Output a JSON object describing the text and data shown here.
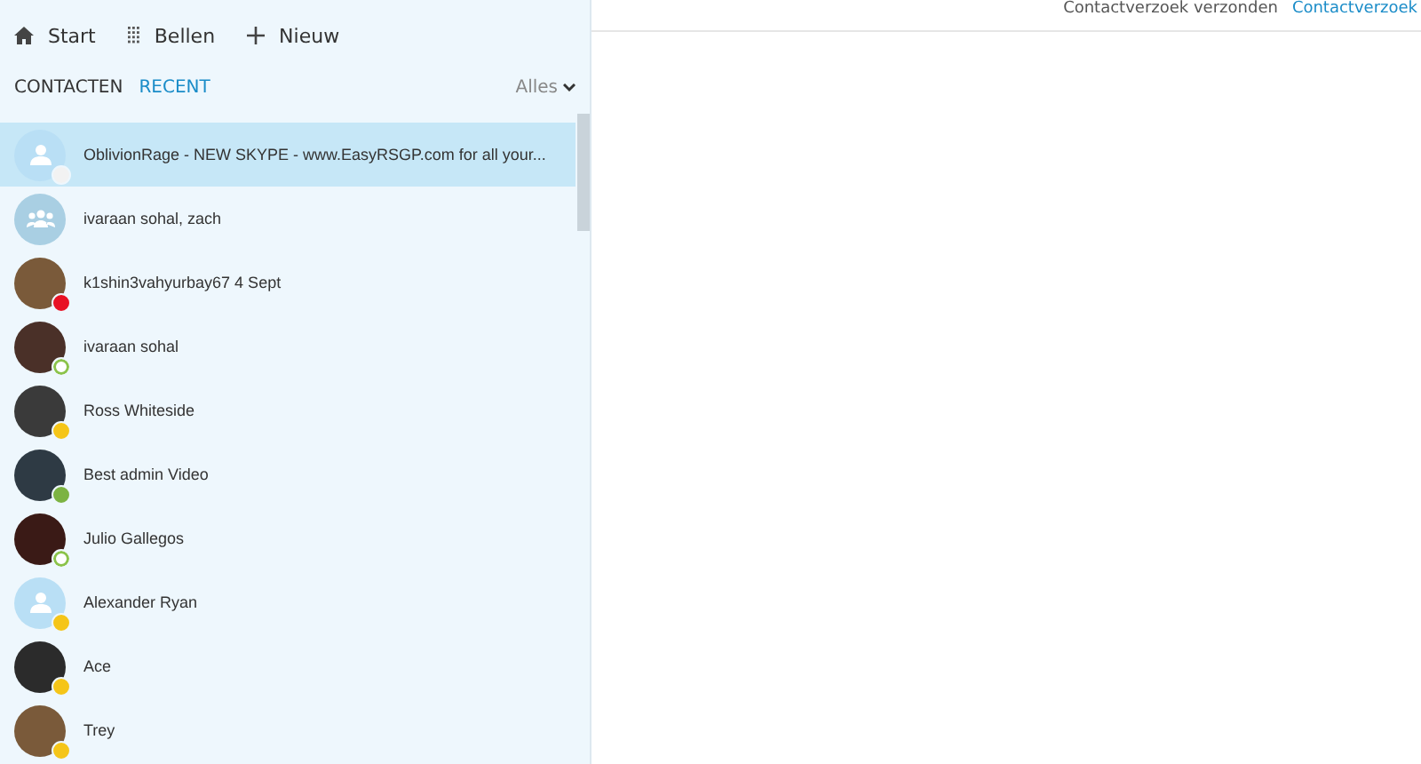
{
  "toolbar": [
    {
      "kind": "home",
      "label": "Start"
    },
    {
      "kind": "dialpad",
      "label": "Bellen"
    },
    {
      "kind": "plus",
      "label": "Nieuw"
    }
  ],
  "tabs": [
    {
      "label": "CONTACTEN",
      "selected": false
    },
    {
      "label": "RECENT",
      "selected": true
    }
  ],
  "filter": {
    "label": "Alles"
  },
  "conversations": [
    {
      "name": "OblivionRage - NEW SKYPE - www.EasyRSGP.com for all your...",
      "avatar": {
        "kind": "person"
      },
      "status": {
        "kind": "unknown"
      },
      "selected": true
    },
    {
      "name": "ivaraan sohal, zach",
      "avatar": {
        "kind": "group"
      },
      "selected": false
    },
    {
      "name": "k1shin3vahyurbay67 4 Sept",
      "avatar": {
        "kind": "photo"
      },
      "status": {
        "kind": "busy"
      },
      "selected": false
    },
    {
      "name": "ivaraan sohal",
      "avatar": {
        "kind": "photo"
      },
      "status": {
        "kind": "offline"
      },
      "selected": false
    },
    {
      "name": "Ross Whiteside",
      "avatar": {
        "kind": "photo"
      },
      "status": {
        "kind": "away"
      },
      "selected": false
    },
    {
      "name": "Best admin Video",
      "avatar": {
        "kind": "photo"
      },
      "status": {
        "kind": "online"
      },
      "selected": false
    },
    {
      "name": "Julio Gallegos",
      "avatar": {
        "kind": "photo"
      },
      "status": {
        "kind": "offline"
      },
      "selected": false
    },
    {
      "name": "Alexander Ryan",
      "avatar": {
        "kind": "person"
      },
      "status": {
        "kind": "away"
      },
      "selected": false
    },
    {
      "name": "Ace",
      "avatar": {
        "kind": "photo"
      },
      "status": {
        "kind": "away"
      },
      "selected": false
    },
    {
      "name": "Trey",
      "avatar": {
        "kind": "photo"
      },
      "status": {
        "kind": "away"
      },
      "selected": false
    }
  ],
  "header": {
    "status_text": "Contactverzoek verzonden",
    "link": "Contactverzoek"
  }
}
